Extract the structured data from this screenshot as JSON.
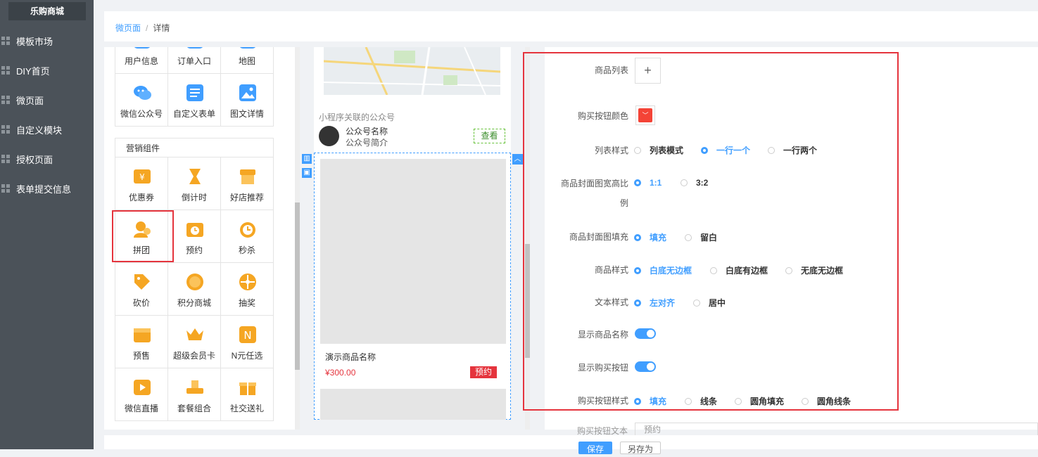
{
  "brand": "乐购商城",
  "nav": [
    {
      "label": "模板市场"
    },
    {
      "label": "DIY首页"
    },
    {
      "label": "微页面"
    },
    {
      "label": "自定义模块"
    },
    {
      "label": "授权页面"
    },
    {
      "label": "表单提交信息"
    }
  ],
  "breadcrumb": {
    "parent": "微页面",
    "separator": "/",
    "current": "详情"
  },
  "components_top": [
    {
      "label": "用户信息",
      "icon": "user-info-icon",
      "color": "#409eff"
    },
    {
      "label": "订单入口",
      "icon": "order-icon",
      "color": "#409eff"
    },
    {
      "label": "地图",
      "icon": "map-icon",
      "color": "#409eff"
    },
    {
      "label": "微信公众号",
      "icon": "wechat-icon",
      "color": "#409eff"
    },
    {
      "label": "自定义表单",
      "icon": "form-icon",
      "color": "#409eff"
    },
    {
      "label": "图文详情",
      "icon": "image-text-icon",
      "color": "#409eff"
    }
  ],
  "marketing_title": "营销组件",
  "components_marketing": [
    {
      "label": "优惠券",
      "icon": "coupon-icon",
      "color": "#f5a623"
    },
    {
      "label": "倒计时",
      "icon": "countdown-icon",
      "color": "#f5a623"
    },
    {
      "label": "好店推荐",
      "icon": "shop-icon",
      "color": "#f5a623"
    },
    {
      "label": "拼团",
      "icon": "group-buy-icon",
      "color": "#f5a623"
    },
    {
      "label": "预约",
      "icon": "reservation-icon",
      "color": "#f5a623"
    },
    {
      "label": "秒杀",
      "icon": "flash-sale-icon",
      "color": "#f5a623"
    },
    {
      "label": "砍价",
      "icon": "bargain-icon",
      "color": "#f5a623"
    },
    {
      "label": "积分商城",
      "icon": "points-icon",
      "color": "#f5a623"
    },
    {
      "label": "抽奖",
      "icon": "lottery-icon",
      "color": "#f5a623"
    },
    {
      "label": "预售",
      "icon": "presale-icon",
      "color": "#f5a623"
    },
    {
      "label": "超级会员卡",
      "icon": "vip-card-icon",
      "color": "#f5a623"
    },
    {
      "label": "N元任选",
      "icon": "n-yuan-icon",
      "color": "#f5a623"
    },
    {
      "label": "微信直播",
      "icon": "live-icon",
      "color": "#f5a623"
    },
    {
      "label": "套餐组合",
      "icon": "combo-icon",
      "color": "#f5a623"
    },
    {
      "label": "社交送礼",
      "icon": "gift-icon",
      "color": "#f5a623"
    }
  ],
  "preview": {
    "pub_title": "小程序关联的公众号",
    "pub_name": "公众号名称",
    "pub_desc": "公众号简介",
    "pub_btn": "查看",
    "product_name": "演示商品名称",
    "product_price": "¥300.00",
    "product_btn": "预约"
  },
  "settings": {
    "product_list": "商品列表",
    "buy_btn_color": "购买按钮颜色",
    "buy_btn_color_value": "#f44336",
    "list_style": "列表样式",
    "list_style_options": [
      "列表模式",
      "一行一个",
      "一行两个"
    ],
    "cover_ratio": "商品封面图宽高比",
    "cover_ratio_line2": "例",
    "cover_ratio_options": [
      "1:1",
      "3:2"
    ],
    "cover_fill": "商品封面图填充",
    "cover_fill_options": [
      "填充",
      "留白"
    ],
    "product_style": "商品样式",
    "product_style_options": [
      "白底无边框",
      "白底有边框",
      "无底无边框"
    ],
    "text_style": "文本样式",
    "text_style_options": [
      "左对齐",
      "居中"
    ],
    "show_name": "显示商品名称",
    "show_buy_btn": "显示购买按钮",
    "buy_btn_style": "购买按钮样式",
    "buy_btn_style_options": [
      "填充",
      "线条",
      "圆角填充",
      "圆角线条"
    ],
    "buy_btn_text": "购买按钮文本",
    "buy_btn_text_value": "预约"
  },
  "footer": {
    "save": "保存",
    "save_as": "另存为"
  }
}
